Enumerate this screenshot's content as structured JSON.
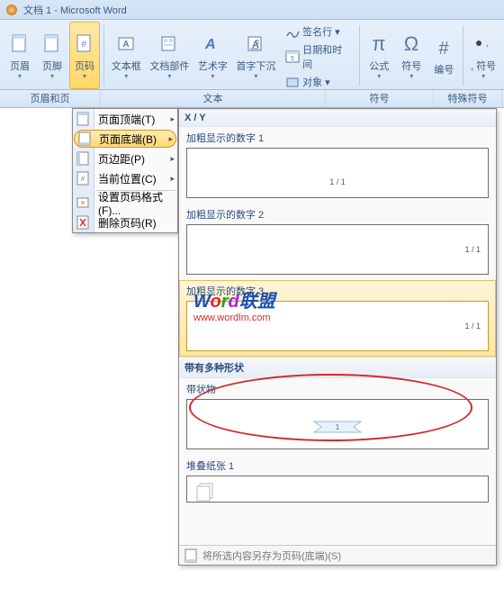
{
  "window": {
    "title": "文档 1 - Microsoft Word"
  },
  "ribbon": {
    "header": "页眉",
    "footer": "页脚",
    "pagenum": "页码",
    "textbox": "文本框",
    "docpart": "文档部件",
    "wordart": "艺术字",
    "dropcap": "首字下沉",
    "signature": "签名行",
    "datetime": "日期和时间",
    "object": "对象",
    "formula": "公式",
    "symbol": "符号",
    "number": "编号",
    "special": "符号"
  },
  "groups": {
    "g1": "页眉和页",
    "g2": "文本",
    "g3": "符号",
    "g4": "特殊符号"
  },
  "menu": {
    "top": "页面顶端(T)",
    "bottom": "页面底端(B)",
    "margin": "页边距(P)",
    "current": "当前位置(C)",
    "format": "设置页码格式(F)...",
    "remove": "删除页码(R)"
  },
  "gallery": {
    "cat1": "X / Y",
    "item1": "加粗显示的数字 1",
    "item2": "加粗显示的数字 2",
    "item3": "加粗显示的数字 3",
    "cat2": "带有多种形状",
    "item4": "带状物",
    "item5": "堆叠纸张 1",
    "pn": "1 / 1",
    "saveas": "将所选内容另存为页码(底端)(S)"
  },
  "watermark": {
    "text": "Word联盟",
    "url": "www.wordlm.com"
  }
}
